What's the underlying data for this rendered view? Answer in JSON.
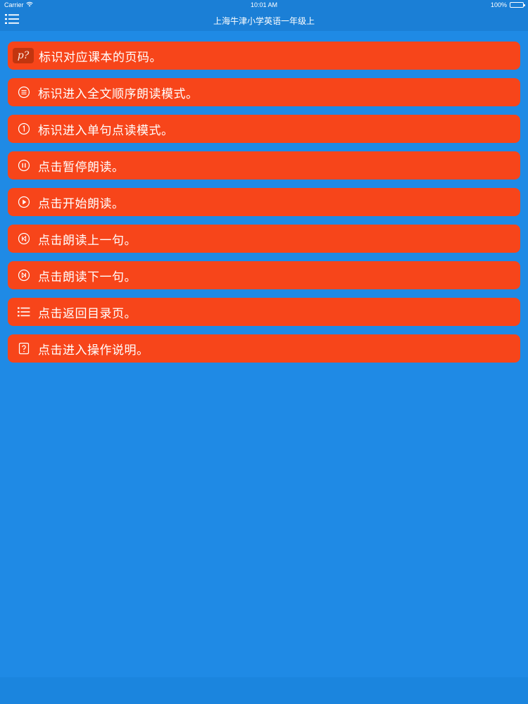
{
  "status_bar": {
    "carrier": "Carrier",
    "time": "10:01 AM",
    "battery": "100%"
  },
  "nav": {
    "title": "上海牛津小学英语一年级上",
    "menu_icon": "list-icon"
  },
  "colors": {
    "background": "#1f8ae5",
    "bar": "#1b7fd6",
    "row": "#f7451a"
  },
  "items": [
    {
      "icon": "page-number-icon",
      "icon_text": "p?",
      "label": "标识对应课本的页码。"
    },
    {
      "icon": "full-text-read-icon",
      "label": "标识进入全文顺序朗读模式。"
    },
    {
      "icon": "single-sentence-icon",
      "label": "标识进入单句点读模式。"
    },
    {
      "icon": "pause-icon",
      "label": "点击暂停朗读。"
    },
    {
      "icon": "play-icon",
      "label": "点击开始朗读。"
    },
    {
      "icon": "previous-icon",
      "label": "点击朗读上一句。"
    },
    {
      "icon": "next-icon",
      "label": "点击朗读下一句。"
    },
    {
      "icon": "list-icon",
      "label": "点击返回目录页。"
    },
    {
      "icon": "help-icon",
      "label": "点击进入操作说明。"
    }
  ]
}
